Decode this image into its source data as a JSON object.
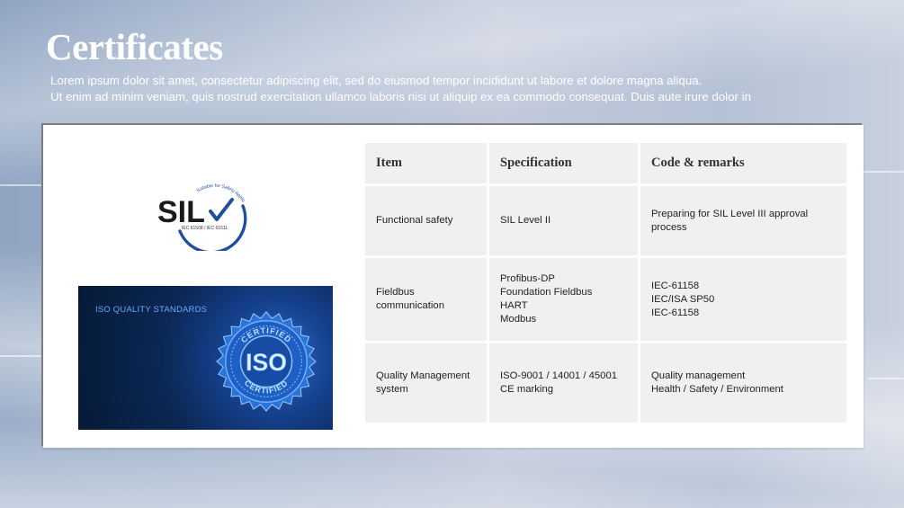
{
  "page": {
    "title": "Certificates",
    "subtitle_lines": [
      "Lorem ipsum dolor sit amet, consectetur adipiscing elit, sed do eiusmod tempor incididunt ut labore et dolore magna aliqua.",
      "Ut enim ad minim veniam, quis nostrud exercitation ullamco laboris nisi ut aliquip ex ea commodo consequat. Duis aute irure dolor in"
    ]
  },
  "sil_logo": {
    "text": "SIL",
    "arc_text": "Suitable for Safety Applications",
    "standards": "IEC 61508 / IEC 61511",
    "accent_color": "#1f4f9c",
    "text_color": "#1a1a1a",
    "icon": "checkmark-icon"
  },
  "iso_image": {
    "caption": "ISO QUALITY STANDARDS",
    "seal_text": "ISO",
    "seal_top": "CERTIFIED",
    "seal_bottom": "CERTIFIED",
    "icon": "certified-seal-icon"
  },
  "table": {
    "headers": [
      "Item",
      "Specification",
      "Code & remarks"
    ],
    "rows": [
      {
        "item": [
          "Functional safety"
        ],
        "spec": [
          "SIL Level II"
        ],
        "remarks": [
          "Preparing for SIL Level III approval",
          "process"
        ]
      },
      {
        "item": [
          "Fieldbus",
          "communication"
        ],
        "spec": [
          "Profibus-DP",
          "Foundation Fieldbus",
          "HART",
          "Modbus"
        ],
        "remarks": [
          "IEC-61158",
          "IEC/ISA SP50",
          "IEC-61158"
        ]
      },
      {
        "item": [
          "Quality Management",
          "system"
        ],
        "spec": [
          "ISO-9001 / 14001 / 45001",
          "CE marking"
        ],
        "remarks": [
          "Quality management",
          "Health / Safety / Environment"
        ]
      }
    ]
  }
}
